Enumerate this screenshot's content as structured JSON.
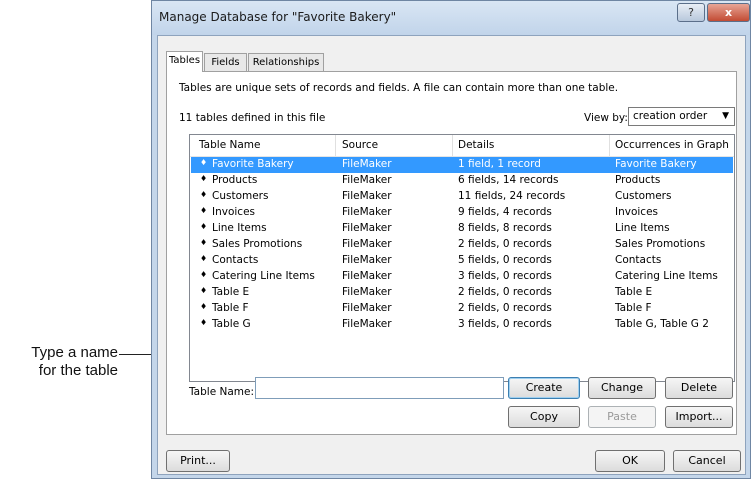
{
  "annotation": {
    "line1": "Type a name",
    "line2": "for the table"
  },
  "window": {
    "title": "Manage Database for \"Favorite Bakery\"",
    "help_label": "?",
    "close_label": "x"
  },
  "tabs": [
    {
      "label": "Tables",
      "active": true
    },
    {
      "label": "Fields",
      "active": false
    },
    {
      "label": "Relationships",
      "active": false
    }
  ],
  "panel": {
    "intro": "Tables are unique sets of records and fields. A file can contain more than one table.",
    "count_text": "11 tables defined in this file",
    "view_by_label": "View by:",
    "view_by_value": "creation order"
  },
  "table": {
    "columns": [
      "Table Name",
      "Source",
      "Details",
      "Occurrences in Graph"
    ],
    "rows": [
      {
        "name": "Favorite Bakery",
        "source": "FileMaker",
        "details": "1 field, 1 record",
        "occurrences": "Favorite Bakery",
        "selected": true
      },
      {
        "name": "Products",
        "source": "FileMaker",
        "details": "6 fields, 14 records",
        "occurrences": "Products"
      },
      {
        "name": "Customers",
        "source": "FileMaker",
        "details": "11 fields, 24 records",
        "occurrences": "Customers"
      },
      {
        "name": "Invoices",
        "source": "FileMaker",
        "details": "9 fields, 4 records",
        "occurrences": "Invoices"
      },
      {
        "name": "Line Items",
        "source": "FileMaker",
        "details": "8 fields, 8 records",
        "occurrences": "Line Items"
      },
      {
        "name": "Sales Promotions",
        "source": "FileMaker",
        "details": "2 fields, 0 records",
        "occurrences": "Sales Promotions"
      },
      {
        "name": "Contacts",
        "source": "FileMaker",
        "details": "5 fields, 0 records",
        "occurrences": "Contacts"
      },
      {
        "name": "Catering Line Items",
        "source": "FileMaker",
        "details": "3 fields, 0 records",
        "occurrences": "Catering Line Items"
      },
      {
        "name": "Table E",
        "source": "FileMaker",
        "details": "2 fields, 0 records",
        "occurrences": "Table E"
      },
      {
        "name": "Table F",
        "source": "FileMaker",
        "details": "2 fields, 0 records",
        "occurrences": "Table F"
      },
      {
        "name": "Table G",
        "source": "FileMaker",
        "details": "3 fields, 0 records",
        "occurrences": "Table G, Table G 2"
      }
    ]
  },
  "form": {
    "table_name_label": "Table Name:",
    "table_name_value": ""
  },
  "buttons": {
    "create": "Create",
    "change": "Change",
    "delete": "Delete",
    "copy": "Copy",
    "paste": "Paste",
    "import": "Import...",
    "print": "Print...",
    "ok": "OK",
    "cancel": "Cancel"
  },
  "colors": {
    "selection": "#3399ff",
    "window_frame": "#c4d6ea"
  }
}
